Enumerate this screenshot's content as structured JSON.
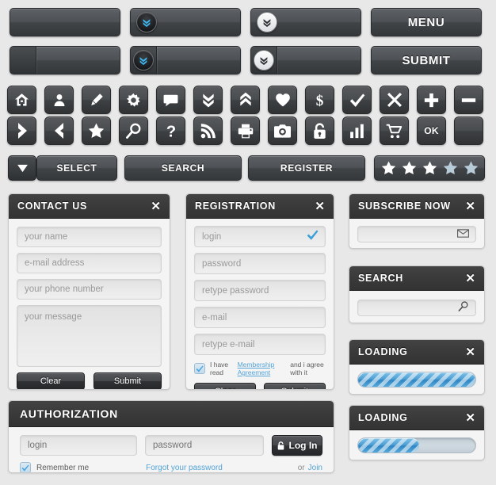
{
  "theme": {
    "background": "#e8e8e8",
    "button_dark": "#414447",
    "header_dark": "#3a3a3a",
    "accent_blue": "#2f9fe0",
    "link_blue": "#54a4d8",
    "star_on": "#ffffff",
    "star_off": "#b8cbd8",
    "progress_blue": "#4e9fd4"
  },
  "top_buttons": {
    "row1": [
      {
        "name": "blank-button",
        "label": "",
        "variant": "plain"
      },
      {
        "name": "chevron-dark-button",
        "label": "",
        "variant": "badge-dark",
        "icon": "double-chevron-down-icon"
      },
      {
        "name": "chevron-light-button",
        "label": "",
        "variant": "badge-light",
        "icon": "double-chevron-down-icon"
      },
      {
        "name": "menu-button",
        "label": "MENU",
        "variant": "plain"
      }
    ],
    "row2": [
      {
        "name": "split-blank-button",
        "label": "",
        "variant": "split"
      },
      {
        "name": "split-chevron-dark-button",
        "label": "",
        "variant": "split-badge-dark",
        "icon": "double-chevron-down-icon"
      },
      {
        "name": "split-chevron-light-button",
        "label": "",
        "variant": "split-badge-light",
        "icon": "double-chevron-down-icon"
      },
      {
        "name": "submit-button",
        "label": "SUBMIT",
        "variant": "plain"
      }
    ]
  },
  "icon_grid": {
    "row1": [
      "home-icon",
      "user-icon",
      "pencil-icon",
      "gear-icon",
      "comment-icon",
      "double-chevron-down-icon",
      "double-chevron-up-icon",
      "heart-icon",
      "dollar-icon",
      "check-icon",
      "close-icon",
      "plus-icon",
      "minus-icon"
    ],
    "row2": [
      "chevron-right-icon",
      "chevron-left-icon",
      "star-icon",
      "search-icon",
      "question-icon",
      "rss-icon",
      "print-icon",
      "camera-icon",
      "lock-icon",
      "chart-bar-icon",
      "cart-icon",
      "ok-icon",
      "blank-icon"
    ],
    "ok_label": "OK"
  },
  "action_row": {
    "select_label": "SELECT",
    "dropdown_icon": "triangle-down-icon",
    "search_label": "SEARCH",
    "register_label": "REGISTER",
    "rating": {
      "total": 5,
      "filled": 3,
      "icon": "star-icon"
    }
  },
  "contact_panel": {
    "title": "CONTACT US",
    "close_icon": "close-icon",
    "fields": [
      {
        "name": "name-input",
        "placeholder": "your name"
      },
      {
        "name": "email-input",
        "placeholder": "e-mail address"
      },
      {
        "name": "phone-input",
        "placeholder": "your phone number"
      }
    ],
    "message": {
      "name": "message-textarea",
      "placeholder": "your message"
    },
    "clear_label": "Clear",
    "submit_label": "Submit"
  },
  "registration_panel": {
    "title": "REGISTRATION",
    "close_icon": "close-icon",
    "fields": [
      {
        "name": "login-input",
        "placeholder": "login",
        "valid": true
      },
      {
        "name": "password-input",
        "placeholder": "password",
        "valid": false
      },
      {
        "name": "retype-password-input",
        "placeholder": "retype password",
        "valid": false
      },
      {
        "name": "email-input",
        "placeholder": "e-mail",
        "valid": false
      },
      {
        "name": "retype-email-input",
        "placeholder": "retype e-mail",
        "valid": false
      }
    ],
    "agreement": {
      "checked": true,
      "text_before": "I have read",
      "link_text": "Membership Agreement",
      "text_after": "and i agree with it"
    },
    "clear_label": "Clear",
    "submit_label": "Submit"
  },
  "subscribe_panel": {
    "title": "SUBSCRIBE NOW",
    "close_icon": "close-icon",
    "field": {
      "name": "subscribe-email-input",
      "placeholder": "",
      "icon": "envelope-icon"
    }
  },
  "search_panel": {
    "title": "SEARCH",
    "close_icon": "close-icon",
    "field": {
      "name": "search-input",
      "placeholder": "",
      "icon": "search-icon"
    }
  },
  "loading_panels": [
    {
      "title": "LOADING",
      "close_icon": "close-icon",
      "progress": 100
    },
    {
      "title": "LOADING",
      "close_icon": "close-icon",
      "progress": 52
    }
  ],
  "authorization_panel": {
    "title": "AUTHORIZATION",
    "close_icon": "close-icon",
    "login": {
      "name": "login-input",
      "placeholder": "login"
    },
    "password": {
      "name": "password-input",
      "placeholder": "password"
    },
    "login_button": {
      "label": "Log In",
      "icon": "lock-icon"
    },
    "remember": {
      "checked": true,
      "label": "Remember me"
    },
    "forgot_link": "Forgot your password",
    "or_text": "or",
    "join_link": "Join"
  }
}
